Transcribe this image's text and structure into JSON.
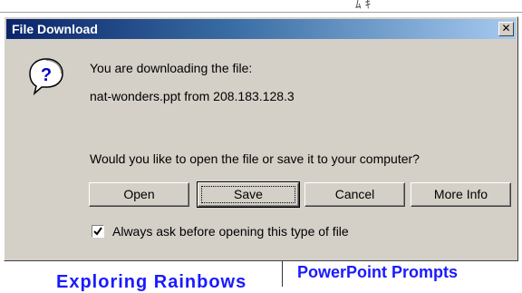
{
  "background": {
    "scribble": "ﾑ  ｷ",
    "bottom_left_text": "Exploring Rainbows",
    "bottom_right_text": "PowerPoint Prompts"
  },
  "dialog": {
    "title": "File Download",
    "close_glyph": "✕",
    "icon": "question-icon",
    "line1": "You are downloading the file:",
    "line2": "nat-wonders.ppt from 208.183.128.3",
    "question": "Would you like to open the file or save it to your computer?",
    "buttons": {
      "open": "Open",
      "save": "Save",
      "cancel": "Cancel",
      "more_info": "More Info"
    },
    "checkbox": {
      "label": "Always ask before opening this type of file",
      "checked": true
    }
  },
  "colors": {
    "title_gradient_start": "#0a246a",
    "title_gradient_end": "#a6caf0",
    "dialog_face": "#d4d0c8",
    "background_link": "#1a1aff"
  }
}
